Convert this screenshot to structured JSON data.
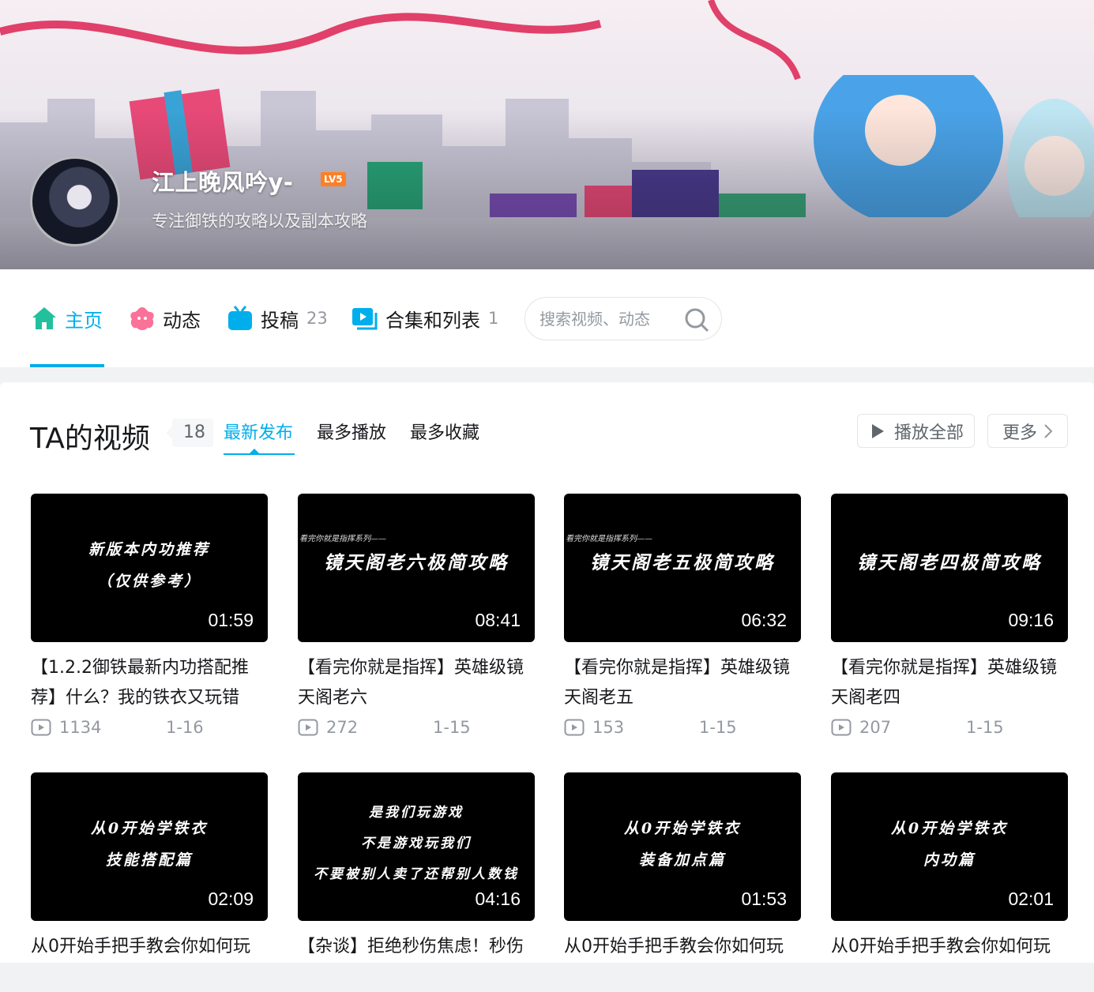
{
  "profile": {
    "username": "江上晚风吟y-",
    "level": "LV5",
    "sign": "专注御铁的攻略以及副本攻略"
  },
  "nav": {
    "items": [
      {
        "label": "主页",
        "icon": "home-icon",
        "count": ""
      },
      {
        "label": "动态",
        "icon": "dynamic-icon",
        "count": ""
      },
      {
        "label": "投稿",
        "icon": "tv-icon",
        "count": "23"
      },
      {
        "label": "合集和列表",
        "icon": "collection-icon",
        "count": "1"
      }
    ],
    "search_placeholder": "搜索视频、动态"
  },
  "videos_section": {
    "title": "TA的视频",
    "count": "18",
    "tabs": [
      "最新发布",
      "最多播放",
      "最多收藏"
    ],
    "play_all": "播放全部",
    "more": "更多"
  },
  "videos": [
    {
      "thumb_small": "",
      "thumb_lines": [
        "新版本内功推荐",
        "（仅供参考）"
      ],
      "duration": "01:59",
      "title": "【1.2.2御铁最新内功搭配推荐】什么？我的铁衣又玩错",
      "plays": "1134",
      "date": "1-16"
    },
    {
      "thumb_small": "看完你就是指挥系列——",
      "thumb_lines": [
        "镜天阁老六极简攻略"
      ],
      "duration": "08:41",
      "title": "【看完你就是指挥】英雄级镜天阁老六",
      "plays": "272",
      "date": "1-15"
    },
    {
      "thumb_small": "看完你就是指挥系列——",
      "thumb_lines": [
        "镜天阁老五极简攻略"
      ],
      "duration": "06:32",
      "title": "【看完你就是指挥】英雄级镜天阁老五",
      "plays": "153",
      "date": "1-15"
    },
    {
      "thumb_small": "",
      "thumb_lines": [
        "镜天阁老四极简攻略"
      ],
      "duration": "09:16",
      "title": "【看完你就是指挥】英雄级镜天阁老四",
      "plays": "207",
      "date": "1-15"
    },
    {
      "thumb_small": "",
      "thumb_lines": [
        "从0开始学铁衣",
        "技能搭配篇"
      ],
      "duration": "02:09",
      "title": "从0开始手把手教会你如何玩",
      "plays": "",
      "date": ""
    },
    {
      "thumb_small": "",
      "thumb_lines": [
        "是我们玩游戏",
        "不是游戏玩我们",
        "不要被别人卖了还帮别人数钱"
      ],
      "duration": "04:16",
      "title": "【杂谈】拒绝秒伤焦虑！秒伤",
      "plays": "",
      "date": ""
    },
    {
      "thumb_small": "",
      "thumb_lines": [
        "从0开始学铁衣",
        "装备加点篇"
      ],
      "duration": "01:53",
      "title": "从0开始手把手教会你如何玩",
      "plays": "",
      "date": ""
    },
    {
      "thumb_small": "",
      "thumb_lines": [
        "从0开始学铁衣",
        "内功篇"
      ],
      "duration": "02:01",
      "title": "从0开始手把手教会你如何玩",
      "plays": "",
      "date": ""
    }
  ],
  "colors": {
    "accent": "#00aeec",
    "level_badge": "#ff7f24",
    "text_secondary": "#9499a0"
  }
}
